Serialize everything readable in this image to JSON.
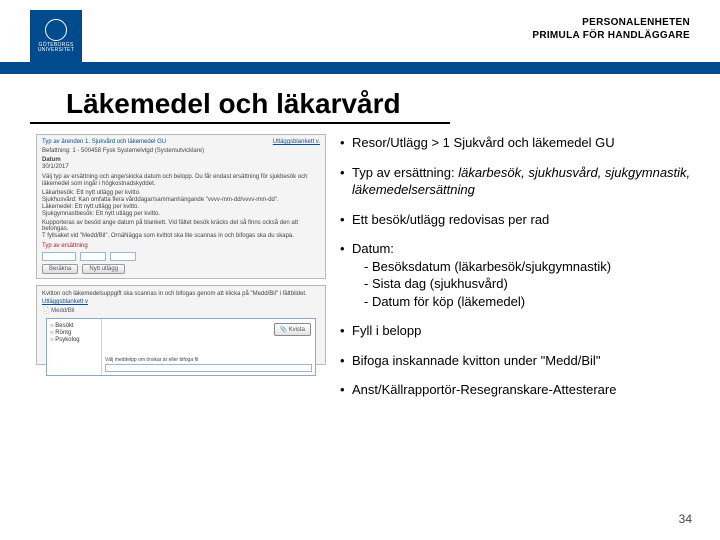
{
  "header": {
    "logo_line1": "GÖTEBORGS",
    "logo_line2": "UNIVERSITET",
    "right_line1": "PERSONALENHETEN",
    "right_line2": "PRIMULA FÖR HANDLÄGGARE"
  },
  "title": "Läkemedel och läkarvård",
  "screenshot1": {
    "breadcrumb_left": "Typ av ärenden 1. Sjukvård och läkemedel GU",
    "breadcrumb_link": "Utläggsblankett v.",
    "befattning": "Befattning: 1 - 500458 Fysk Systemelvtgd (Systemutvicklare)",
    "datum": "Datum",
    "datum_val": "30/1/2017",
    "instr1": "Välj typ av ersättning och ange/skicka datum och belopp. Du får endast ersättning för sjukbesök och",
    "instr2": "läkemedel som ingår i högkostnadskyddet.",
    "ex1": "Läkarbesök:   Ett nytt utlägg per kvitto.",
    "ex2": "Sjukhusvård:  Kan omfatta flera vårddagar/sammanhängande \"vvvv-mm-dd/vvvv-mm-dd\".",
    "ex3": "Läkemedel:    Ett nytt utlägg per kvitto.",
    "ex4": "Sjukgymnastbesök: Ett nytt utlägg per kvitto.",
    "kopp": "Kupporteras av besöd ange datum på blankett. Vid fältet besök kräcks det så finns också den att betongas.",
    "kopp2": "T fyllsaket vid \"Medd/Bil\". OrnäNägga som kvittot ska lite scannas in och bifogas ska du skapa.",
    "section": "Typ av ersättning",
    "btn_calc": "Beräkna",
    "btn_new": "Nytt utlägg"
  },
  "screenshot2": {
    "note": "Kvitton och läkemedelsuppgift ska scannas in och bifogas genom att klicka på \"Medd/Bil\" i fältbildet.",
    "tab": "Utläggsblankett v",
    "medbil": "Medd/Bil",
    "r1": "Besökt",
    "r2": "Röntg",
    "r3": "Psykolog",
    "attach": "Kvista",
    "bottom": "Välj meddelpp om önskar är eller bifoga fil"
  },
  "bullets": {
    "b1": "Resor/Utlägg > 1 Sjukvård och läkemedel GU",
    "b2a": "Typ av ersättning: ",
    "b2b": "läkarbesök, sjukhusvård, sjukgymnastik, läkemedelsersättning",
    "b3": "Ett besök/utlägg redovisas per rad",
    "b4": "Datum:",
    "b4s1": "- Besöksdatum (läkarbesök/sjukgymnastik)",
    "b4s2": "- Sista dag (sjukhusvård)",
    "b4s3": "- Datum för köp (läkemedel)",
    "b5": "Fyll i belopp",
    "b6": "Bifoga inskannade kvitton under \"Medd/Bil\"",
    "b7": "Anst/Källrapportör-Resegranskare-Attesterare"
  },
  "page": "34"
}
